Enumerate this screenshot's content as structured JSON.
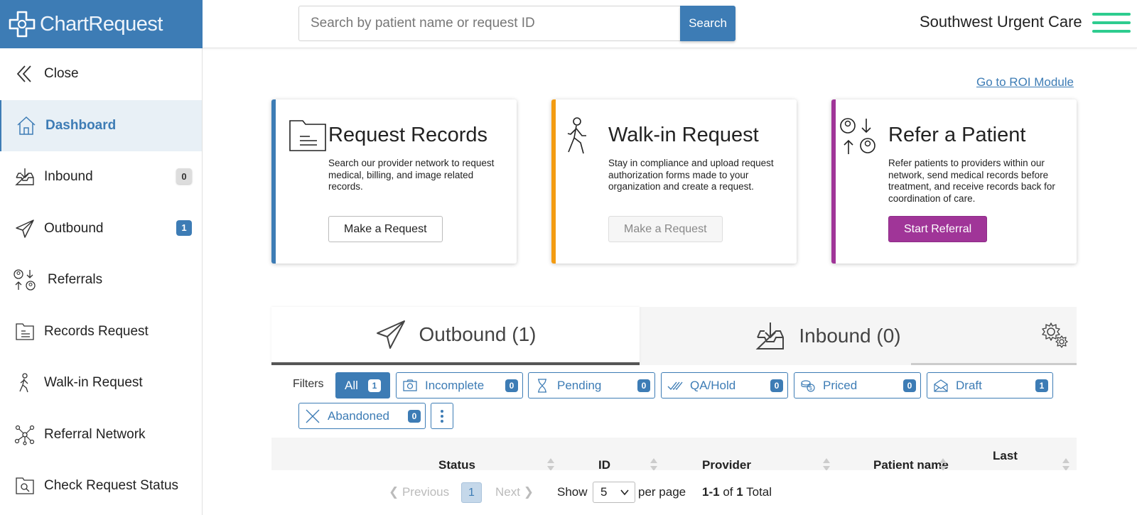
{
  "header": {
    "logo_text": "ChartRequest",
    "search_placeholder": "Search by patient name or request ID",
    "search_button": "Search",
    "org_name": "Southwest Urgent Care"
  },
  "sidebar": {
    "items": [
      {
        "label": "Close",
        "icon": "chevron-double-left-icon"
      },
      {
        "label": "Dashboard",
        "icon": "home-icon",
        "active": true
      },
      {
        "label": "Inbound",
        "icon": "inbox-download-icon",
        "badge": "0"
      },
      {
        "label": "Outbound",
        "icon": "paper-plane-icon",
        "badge": "1"
      },
      {
        "label": "Referrals",
        "icon": "referral-users-icon"
      },
      {
        "label": "Records Request",
        "icon": "folder-document-icon"
      },
      {
        "label": "Walk-in Request",
        "icon": "walking-person-icon"
      },
      {
        "label": "Referral Network",
        "icon": "network-icon"
      },
      {
        "label": "Check Request Status",
        "icon": "folder-search-icon"
      }
    ]
  },
  "main": {
    "roi_link": "Go to ROI Module",
    "cards": [
      {
        "title": "Request Records",
        "description": "Search our provider network to request medical, billing, and image related records.",
        "button": "Make a Request",
        "accent": "#3d7cb5"
      },
      {
        "title": "Walk-in Request",
        "description": "Stay in compliance and upload request authorization forms made to your organization and create a request.",
        "button": "Make a Request",
        "accent": "#f39c12"
      },
      {
        "title": "Refer a Patient",
        "description": "Refer patients to providers within our network, send medical records before treatment, and receive records back for coordination of care.",
        "button": "Start Referral",
        "accent": "#a03598"
      }
    ],
    "tabs": [
      {
        "label": "Outbound (1)",
        "active": true
      },
      {
        "label": "Inbound (0)"
      }
    ],
    "filters_label": "Filters",
    "filters": [
      {
        "label": "All",
        "count": "1"
      },
      {
        "label": "Incomplete",
        "count": "0"
      },
      {
        "label": "Pending",
        "count": "0"
      },
      {
        "label": "QA/Hold",
        "count": "0"
      },
      {
        "label": "Priced",
        "count": "0"
      },
      {
        "label": "Draft",
        "count": "1"
      },
      {
        "label": "Abandoned",
        "count": "0"
      }
    ],
    "table_headers": [
      "Status",
      "ID",
      "Provider",
      "Patient name",
      "Last"
    ],
    "pagination": {
      "previous": "Previous",
      "current_page": "1",
      "next": "Next",
      "show": "Show",
      "page_size": "5",
      "per_page": "per page",
      "range": "1-1",
      "of": "of",
      "total": "1",
      "total_label": "Total"
    }
  },
  "colors": {
    "brand": "#3d7cb5",
    "menu_accent": "#2ecc8f",
    "walkin_accent": "#f39c12",
    "referral_accent": "#a03598"
  }
}
